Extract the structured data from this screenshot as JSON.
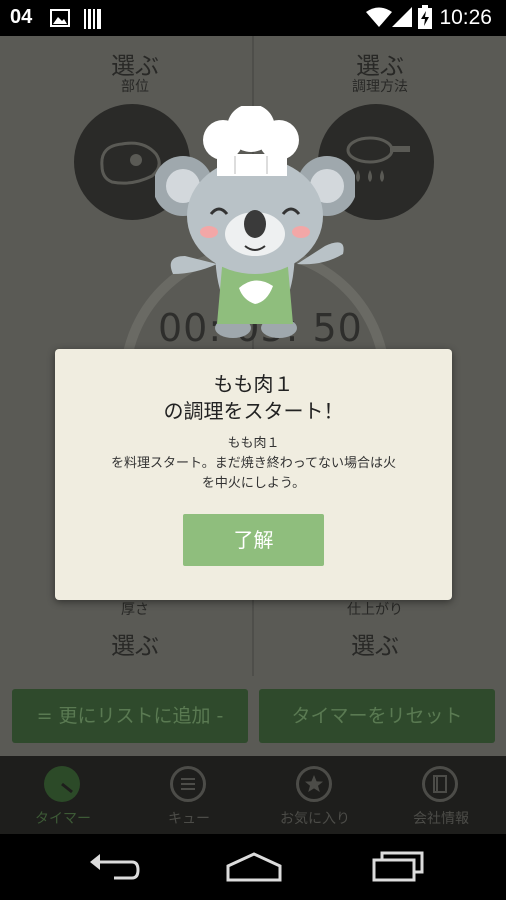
{
  "status_bar": {
    "left_text": "04",
    "time": "10:26",
    "icons": [
      "image-icon",
      "barcode-icon",
      "wifi-icon",
      "signal-icon",
      "battery-charging-icon"
    ]
  },
  "quadrants": {
    "top_left": {
      "title": "選ぶ",
      "label": "部位"
    },
    "top_right": {
      "title": "選ぶ",
      "label": "調理方法"
    },
    "bottom_left": {
      "title": "選ぶ",
      "label": "厚さ"
    },
    "bottom_right": {
      "title": "選ぶ",
      "label": "仕上がり"
    }
  },
  "timer": {
    "display": "00: 05: 50"
  },
  "buttons": {
    "add_to_list": "= 更にリストに追加 -",
    "reset_timer": "タイマーをリセット"
  },
  "tabs": [
    {
      "label": "タイマー",
      "icon": "timer-icon"
    },
    {
      "label": "キュー",
      "icon": "list-icon"
    },
    {
      "label": "お気に入り",
      "icon": "star-icon"
    },
    {
      "label": "会社情報",
      "icon": "book-icon"
    }
  ],
  "dialog": {
    "title_line1": "もも肉１",
    "title_line2": "の調理をスタート！",
    "message_line1": "もも肉１",
    "message_line2": "を料理スタート。まだ焼き終わってない場合は火",
    "message_line3": "を中火にしよう。",
    "ok_label": "了解"
  },
  "colors": {
    "dialog_bg": "#f0ede0",
    "ok_button": "#8fbe7d",
    "overlay_dim": "#5a5a55",
    "dim_button": "#2f4a2c"
  }
}
